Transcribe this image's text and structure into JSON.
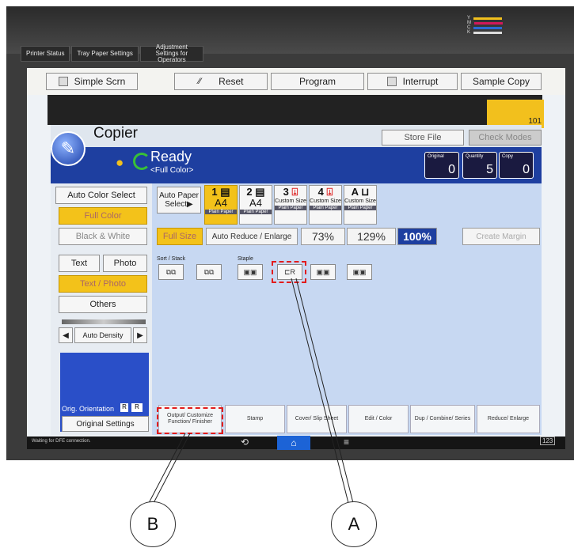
{
  "top_tabs": [
    "Printer Status",
    "Tray Paper Settings",
    "Adjustment Settings for Operators"
  ],
  "toner": [
    "Y",
    "M",
    "C",
    "K"
  ],
  "toner_colors": [
    "#f2c01d",
    "#d1185b",
    "#2a6ad6",
    "#222222"
  ],
  "toolbar": {
    "simple_scrn": "Simple Scrn",
    "reset": "Reset",
    "program": "Program",
    "interrupt": "Interrupt",
    "sample_copy": "Sample Copy"
  },
  "counter_badge": "101",
  "copier": {
    "title": "Copier",
    "store_file": "Store File",
    "check_modes": "Check Modes"
  },
  "status": {
    "ready": "Ready",
    "mode": "<Full Color>",
    "original_label": "Original",
    "original_value": "0",
    "quantity_label": "Quantity",
    "quantity_value": "5",
    "copy_label": "Copy",
    "copy_value": "0"
  },
  "color_modes": {
    "auto_color_select": "Auto Color Select",
    "full_color": "Full Color",
    "black_white": "Black & White"
  },
  "original_type": {
    "text": "Text",
    "photo": "Photo",
    "text_photo": "Text / Photo",
    "others": "Others"
  },
  "density": {
    "label": "Auto Density"
  },
  "orientation": {
    "label": "Orig. Orientation",
    "settings": "Original Settings"
  },
  "paper": {
    "auto_paper_select": "Auto Paper Select▶",
    "trays": [
      {
        "num": "1",
        "size": "A4",
        "type": "Plain Paper"
      },
      {
        "num": "2",
        "size": "A4",
        "type": "Plain Paper"
      },
      {
        "num": "3",
        "size": "Custom Size",
        "type": "Plain Paper"
      },
      {
        "num": "4",
        "size": "Custom Size",
        "type": "Plain Paper"
      },
      {
        "num": "A",
        "size": "Custom Size",
        "type": "Plain Paper"
      }
    ]
  },
  "reduce_enlarge": {
    "full_size": "Full Size",
    "auto_reduce": "Auto Reduce / Enlarge",
    "r73": "73%",
    "r129": "129%",
    "r100": "100%",
    "create_margin": "Create Margin"
  },
  "finisher": {
    "sort_stack_label": "Sort / Stack",
    "staple_label": "Staple"
  },
  "bottom_tabs": [
    "Output/ Customize Function/ Finisher",
    "Stamp",
    "Cover/ Slip Sheet",
    "Edit / Color",
    "Dup / Combine/ Series",
    "Reduce/ Enlarge"
  ],
  "statusbar": {
    "message": "Waiting for DFE connection.",
    "keyboard": "123"
  },
  "callouts": {
    "a": "A",
    "b": "B"
  }
}
